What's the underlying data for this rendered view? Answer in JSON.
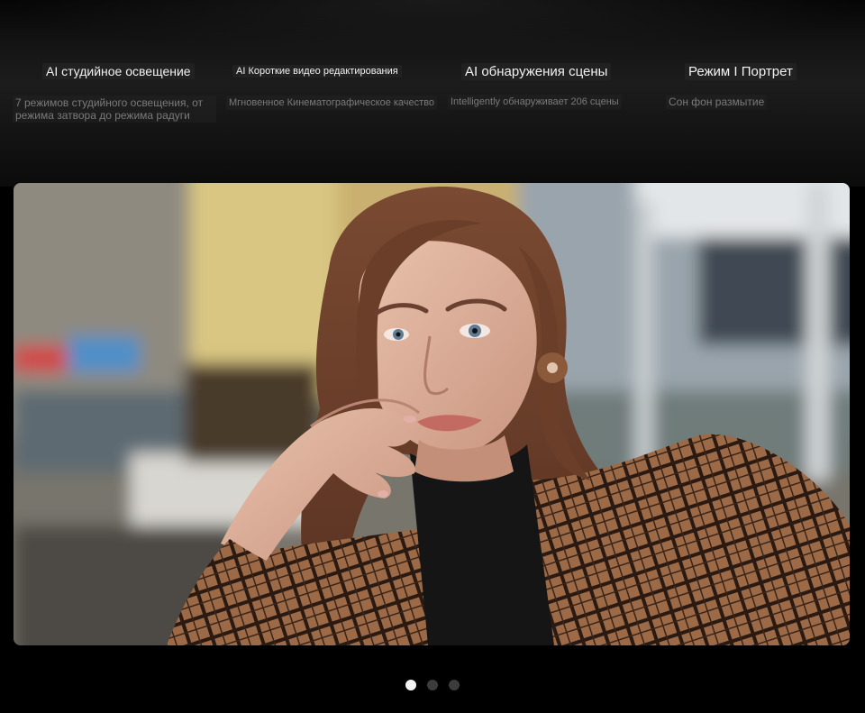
{
  "features": [
    {
      "title": "AI студийное освещение",
      "description": "7 режимов студийного освещения, от режима затвора до режима радуги"
    },
    {
      "title": "AI Короткие видео редактирования",
      "description": "Мгновенное Кинематографическое качество"
    },
    {
      "title": "AI обнаружения сцены",
      "description": "Intelligently обнаруживает 206 сцены"
    },
    {
      "title": "Режим I Портрет",
      "description": "Сон фон размытие"
    }
  ],
  "carousel": {
    "slide_count": 3,
    "active_index": 0
  },
  "colors": {
    "dot_active": "#f4f4f4",
    "dot_inactive": "#3c3c3c",
    "title_text": "#f2f2f2",
    "desc_text": "#7a7a7a"
  }
}
